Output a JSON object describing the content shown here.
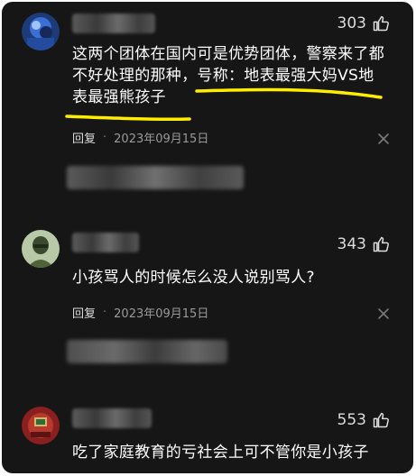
{
  "comments": [
    {
      "avatar": "blue-character-avatar",
      "likes": "303",
      "text_line1": "这两个团体在国内可是优势团体，警察来了都",
      "text_line2": "不好处理的那种，号称：地表最强大妈VS地",
      "text_line3": "表最强熊孩子",
      "reply_label": "回复",
      "separator": "·",
      "date": "2023年09月15日"
    },
    {
      "avatar": "soldier-avatar",
      "likes": "343",
      "text_line1": "小孩骂人的时候怎么没人说别骂人?",
      "reply_label": "回复",
      "separator": "·",
      "date": "2023年09月15日"
    },
    {
      "avatar": "red-avatar",
      "likes": "553",
      "text_line1": "吃了家庭教育的亏社会上可不管你是小孩子"
    }
  ],
  "colors": {
    "background": "#161616",
    "text": "#ffffff",
    "meta": "#9a9a9a",
    "highlight": "#ffee00"
  }
}
